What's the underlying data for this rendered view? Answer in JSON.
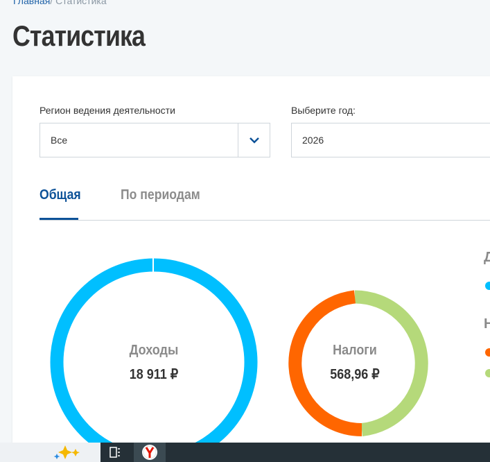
{
  "breadcrumb": {
    "home": "Главная",
    "separator": "/",
    "current": "Статистика"
  },
  "page": {
    "title": "Статистика"
  },
  "filters": {
    "region": {
      "label": "Регион ведения деятельности",
      "value": "Все",
      "icon": "chevron-down-icon"
    },
    "year": {
      "label": "Выберите год:",
      "value": "2026"
    }
  },
  "tabs": [
    {
      "label": "Общая",
      "active": true
    },
    {
      "label": "По периодам",
      "active": false
    }
  ],
  "charts": {
    "income": {
      "label": "Доходы",
      "value": "18 911 ₽",
      "color": "#00bfff"
    },
    "taxes": {
      "label": "Налоги",
      "value": "568,96 ₽",
      "colors": [
        "#ff6600",
        "#b5d97a"
      ]
    }
  },
  "legend": {
    "heading_1": "Д",
    "heading_2": "Н",
    "colors": [
      "#00bfff",
      "#ff6600",
      "#b5d97a"
    ]
  },
  "taskbar": {
    "icons": [
      "sparkle-icon",
      "task-view-icon",
      "yandex-browser-icon"
    ]
  },
  "colors": {
    "accent": "#0d5298",
    "link": "#2063a8"
  }
}
